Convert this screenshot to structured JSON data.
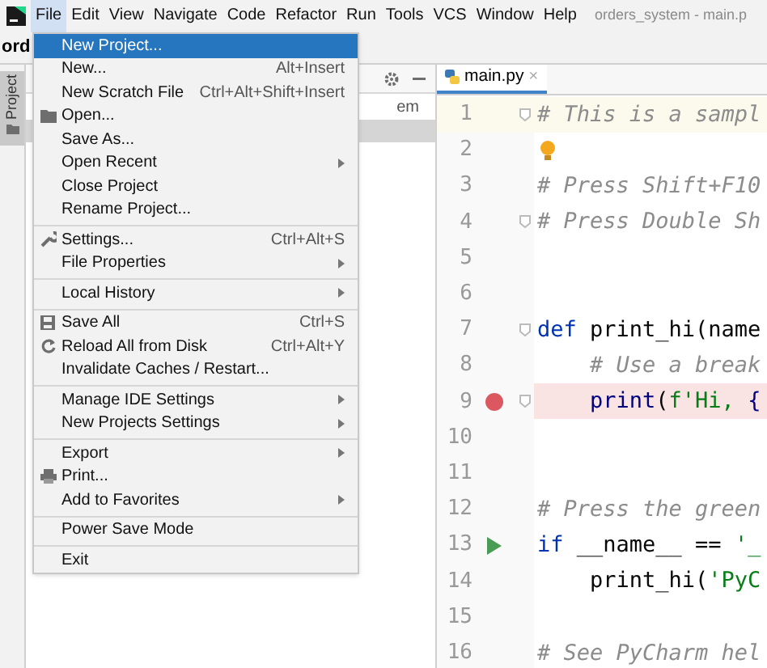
{
  "menu_bar": [
    {
      "label": "File",
      "selected": true
    },
    {
      "label": "Edit",
      "selected": false
    },
    {
      "label": "View",
      "selected": false
    },
    {
      "label": "Navigate",
      "selected": false
    },
    {
      "label": "Code",
      "selected": false
    },
    {
      "label": "Refactor",
      "selected": false
    },
    {
      "label": "Run",
      "selected": false
    },
    {
      "label": "Tools",
      "selected": false
    },
    {
      "label": "VCS",
      "selected": false
    },
    {
      "label": "Window",
      "selected": false
    },
    {
      "label": "Help",
      "selected": false
    }
  ],
  "window_title": "orders_system - main.p",
  "breadcrumb": "ord",
  "tool_window_tab": {
    "label": "Project"
  },
  "project_panel": {
    "row_text": "em"
  },
  "file_menu": [
    {
      "kind": "item",
      "label": "New Project...",
      "selected": true
    },
    {
      "kind": "item",
      "label": "New...",
      "shortcut": "Alt+Insert",
      "selected": false
    },
    {
      "kind": "item",
      "label": "New Scratch File",
      "shortcut": "Ctrl+Alt+Shift+Insert",
      "selected": false
    },
    {
      "kind": "item",
      "label": "Open...",
      "selected": false
    },
    {
      "kind": "item",
      "label": "Save As...",
      "selected": false
    },
    {
      "kind": "item",
      "label": "Open Recent",
      "submenu": true,
      "selected": false
    },
    {
      "kind": "item",
      "label": "Close Project",
      "selected": false
    },
    {
      "kind": "item",
      "label": "Rename Project...",
      "selected": false
    },
    {
      "kind": "separator"
    },
    {
      "kind": "item",
      "label": "Settings...",
      "shortcut": "Ctrl+Alt+S",
      "selected": false
    },
    {
      "kind": "item",
      "label": "File Properties",
      "submenu": true,
      "selected": false
    },
    {
      "kind": "separator"
    },
    {
      "kind": "item",
      "label": "Local History",
      "submenu": true,
      "selected": false
    },
    {
      "kind": "separator"
    },
    {
      "kind": "item",
      "label": "Save All",
      "shortcut": "Ctrl+S",
      "selected": false
    },
    {
      "kind": "item",
      "label": "Reload All from Disk",
      "shortcut": "Ctrl+Alt+Y",
      "selected": false
    },
    {
      "kind": "item",
      "label": "Invalidate Caches / Restart...",
      "selected": false
    },
    {
      "kind": "separator"
    },
    {
      "kind": "item",
      "label": "Manage IDE Settings",
      "submenu": true,
      "selected": false
    },
    {
      "kind": "item",
      "label": "New Projects Settings",
      "submenu": true,
      "selected": false
    },
    {
      "kind": "separator"
    },
    {
      "kind": "item",
      "label": "Export",
      "submenu": true,
      "selected": false
    },
    {
      "kind": "item",
      "label": "Print...",
      "selected": false
    },
    {
      "kind": "item",
      "label": "Add to Favorites",
      "submenu": true,
      "selected": false
    },
    {
      "kind": "separator"
    },
    {
      "kind": "item",
      "label": "Power Save Mode",
      "selected": false
    },
    {
      "kind": "separator"
    },
    {
      "kind": "item",
      "label": "Exit",
      "selected": false
    }
  ],
  "editor": {
    "tab": {
      "label": "main.py",
      "close": "×",
      "selected": true
    },
    "lines": [
      {
        "number": "1",
        "current": true,
        "fold": true,
        "tokens": [
          {
            "kind": "comment",
            "text": "# This is a sampl"
          }
        ]
      },
      {
        "number": "2",
        "bulb": true
      },
      {
        "number": "3",
        "tokens": [
          {
            "kind": "comment",
            "text": "# Press Shift+F10"
          }
        ]
      },
      {
        "number": "4",
        "fold": true,
        "tokens": [
          {
            "kind": "comment",
            "text": "# Press Double Sh"
          }
        ]
      },
      {
        "number": "5"
      },
      {
        "number": "6"
      },
      {
        "number": "7",
        "fold": true,
        "tokens": [
          {
            "kind": "keyword",
            "text": "def"
          },
          {
            "kind": "plain",
            "text": " print_hi(name"
          }
        ]
      },
      {
        "number": "8",
        "indented": true,
        "tokens": [
          {
            "kind": "comment",
            "text": "# Use a break"
          }
        ]
      },
      {
        "number": "9",
        "breakpoint": true,
        "fold": true,
        "indented": true,
        "tokens": [
          {
            "kind": "builtin",
            "text": "print"
          },
          {
            "kind": "plain",
            "text": "("
          },
          {
            "kind": "string",
            "text": "f'Hi, "
          },
          {
            "kind": "builtin",
            "text": "{"
          }
        ]
      },
      {
        "number": "10"
      },
      {
        "number": "11"
      },
      {
        "number": "12",
        "tokens": [
          {
            "kind": "comment",
            "text": "# Press the green"
          }
        ]
      },
      {
        "number": "13",
        "run": true,
        "tokens": [
          {
            "kind": "keyword",
            "text": "if"
          },
          {
            "kind": "plain",
            "text": " __name__ == "
          },
          {
            "kind": "string",
            "text": "'_"
          }
        ]
      },
      {
        "number": "14",
        "indented": true,
        "tokens": [
          {
            "kind": "plain",
            "text": "print_hi("
          },
          {
            "kind": "string",
            "text": "'PyC"
          }
        ]
      },
      {
        "number": "15"
      },
      {
        "number": "16",
        "tokens": [
          {
            "kind": "comment",
            "text": "# See PyCharm hel"
          }
        ]
      }
    ]
  }
}
